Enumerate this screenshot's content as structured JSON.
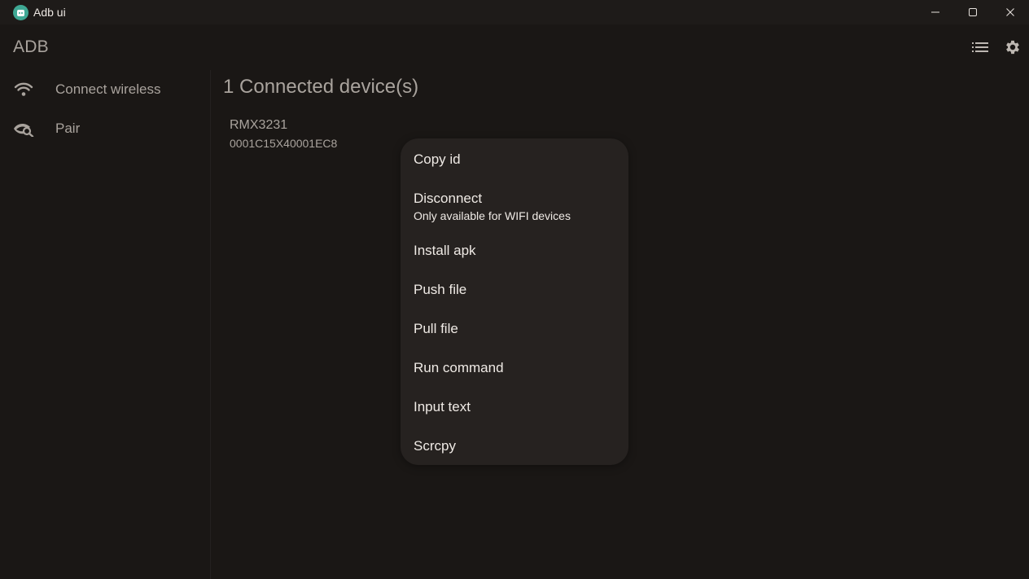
{
  "window": {
    "title": "Adb ui",
    "controls": [
      "minimize-icon",
      "maximize-icon",
      "close-icon"
    ]
  },
  "header": {
    "title": "ADB",
    "icons": [
      "list-icon",
      "gear-icon"
    ]
  },
  "sidebar": {
    "items": [
      {
        "label": "Connect wireless",
        "icon": "wifi-icon"
      },
      {
        "label": "Pair",
        "icon": "eye-search-icon"
      }
    ]
  },
  "main": {
    "title": "1 Connected device(s)",
    "devices": [
      {
        "name": "RMX3231",
        "id": "0001C15X40001EC8"
      }
    ]
  },
  "context_menu": {
    "items": [
      {
        "label": "Copy id"
      },
      {
        "label": "Disconnect",
        "sublabel": "Only available for WIFI devices"
      },
      {
        "label": "Install apk"
      },
      {
        "label": "Push file"
      },
      {
        "label": "Pull file"
      },
      {
        "label": "Run command"
      },
      {
        "label": "Input text"
      },
      {
        "label": "Scrcpy"
      }
    ]
  },
  "colors": {
    "background": "#1a1715",
    "titlebar": "#1e1b19",
    "menu": "#262220",
    "text_muted": "#a9a39d",
    "text": "#efeae5",
    "app_icon": "#3fa894"
  }
}
